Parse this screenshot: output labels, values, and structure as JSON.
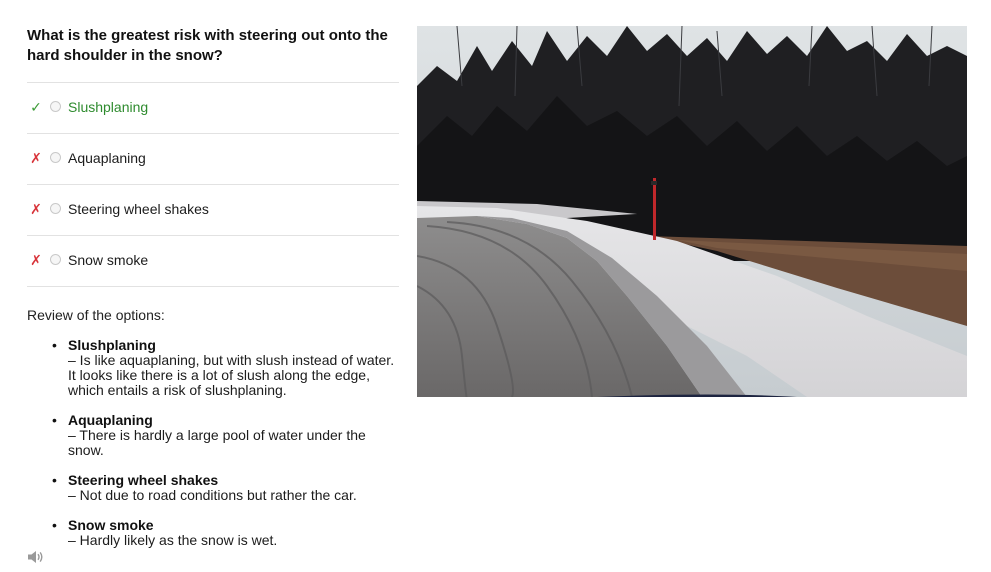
{
  "question": "What is the greatest risk with steering out onto the hard shoulder in the snow?",
  "options": [
    {
      "label": "Slushplaning",
      "status": "correct",
      "mark": "✓"
    },
    {
      "label": "Aquaplaning",
      "status": "wrong",
      "mark": "✗"
    },
    {
      "label": "Steering wheel shakes",
      "status": "wrong",
      "mark": "✗"
    },
    {
      "label": "Snow smoke",
      "status": "wrong",
      "mark": "✗"
    }
  ],
  "review": {
    "heading": "Review of the options:",
    "items": [
      {
        "title": "Slushplaning",
        "text": "– Is like aquaplaning, but with slush instead of water. It looks like there is a lot of slush along the edge, which entails a risk of slushplaning."
      },
      {
        "title": "Aquaplaning",
        "text": "– There is hardly a large pool of water under the snow."
      },
      {
        "title": "Steering wheel shakes",
        "text": "– Not due to road conditions but rather the car."
      },
      {
        "title": "Snow smoke",
        "text": "– Hardly likely as the snow is wet."
      }
    ]
  },
  "colors": {
    "correct": "#3a9a35",
    "wrong": "#d8343a",
    "divider": "#e2e2e2"
  },
  "icons": {
    "speaker": "speaker-icon"
  }
}
